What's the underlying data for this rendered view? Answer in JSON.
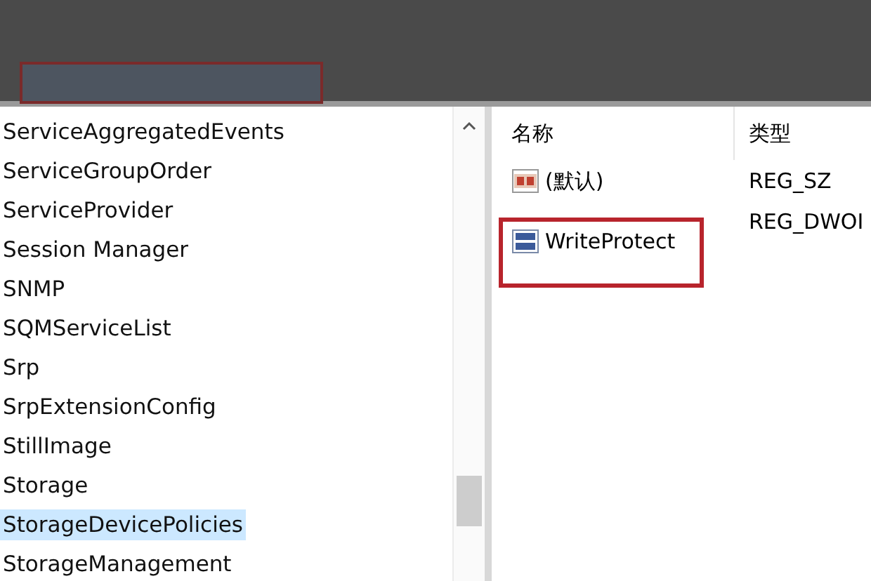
{
  "tree": {
    "items": [
      {
        "label": "ServiceAggregatedEvents",
        "selected": false
      },
      {
        "label": "ServiceGroupOrder",
        "selected": false
      },
      {
        "label": "ServiceProvider",
        "selected": false
      },
      {
        "label": "Session Manager",
        "selected": false
      },
      {
        "label": "SNMP",
        "selected": false
      },
      {
        "label": "SQMServiceList",
        "selected": false
      },
      {
        "label": "Srp",
        "selected": false
      },
      {
        "label": "SrpExtensionConfig",
        "selected": false
      },
      {
        "label": "StillImage",
        "selected": false
      },
      {
        "label": "Storage",
        "selected": false
      },
      {
        "label": "StorageDevicePolicies",
        "selected": true
      },
      {
        "label": "StorageManagement",
        "selected": false
      }
    ]
  },
  "values": {
    "columns": [
      "名称",
      "类型"
    ],
    "rows": [
      {
        "kind": "string",
        "name": "(默认)",
        "type": "REG_SZ",
        "highlighted": false
      },
      {
        "kind": "dword",
        "name": "WriteProtect",
        "type": "REG_DWOI",
        "highlighted": true
      }
    ]
  }
}
